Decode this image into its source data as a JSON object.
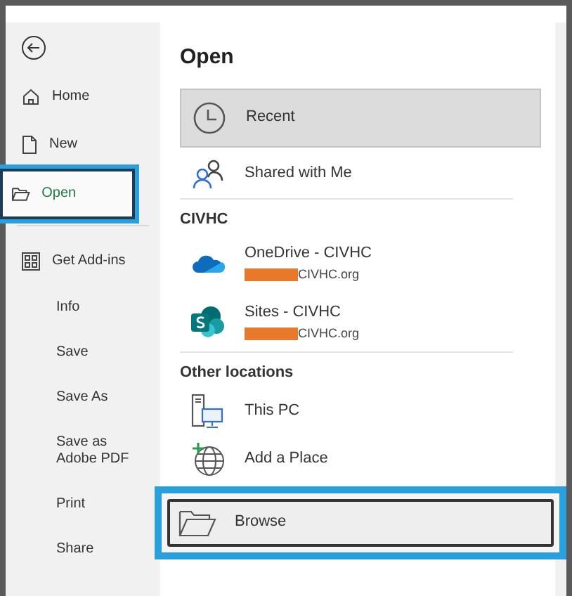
{
  "sidebar": {
    "items": [
      {
        "label": "Home",
        "kind": "home",
        "selected": false,
        "callout": false
      },
      {
        "label": "New",
        "kind": "new",
        "selected": false,
        "callout": false
      },
      {
        "label": "Open",
        "kind": "open",
        "selected": true,
        "callout": true
      },
      {
        "label": "Get Add-ins",
        "kind": "addins",
        "selected": false,
        "callout": false
      },
      {
        "label": "Info",
        "selected": false,
        "callout": false
      },
      {
        "label": "Save",
        "selected": false,
        "callout": false
      },
      {
        "label": "Save As",
        "selected": false,
        "callout": false
      },
      {
        "label": "Save as Adobe PDF",
        "selected": false,
        "callout": false
      },
      {
        "label": "Print",
        "selected": false,
        "callout": false
      },
      {
        "label": "Share",
        "selected": false,
        "callout": false
      }
    ]
  },
  "main": {
    "title": "Open",
    "sections": [
      {
        "items": [
          {
            "label": "Recent",
            "kind": "clock",
            "selected": true,
            "callout": false
          },
          {
            "label": "Shared with Me",
            "kind": "people",
            "selected": false,
            "callout": false
          }
        ]
      },
      {
        "heading": "CIVHC",
        "items": [
          {
            "label": "OneDrive - CIVHC",
            "sub": "CIVHC.org",
            "kind": "cloud",
            "selected": false,
            "callout": false
          },
          {
            "label": "Sites - CIVHC",
            "sub": "CIVHC.org",
            "kind": "sites",
            "selected": false,
            "callout": false
          }
        ]
      },
      {
        "heading": "Other locations",
        "items": [
          {
            "label": "This PC",
            "kind": "pc",
            "selected": false,
            "callout": false
          },
          {
            "label": "Add a Place",
            "kind": "globe",
            "selected": false,
            "callout": false
          },
          {
            "label": "Browse",
            "kind": "folder",
            "selected": false,
            "callout": true
          }
        ]
      }
    ]
  }
}
